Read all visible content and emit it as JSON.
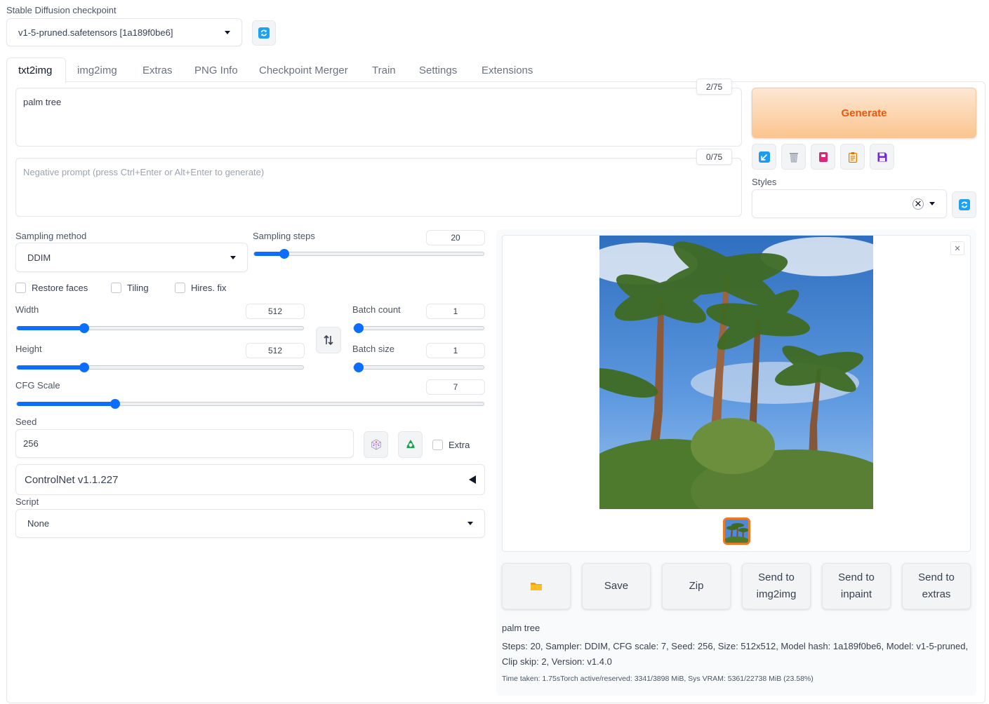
{
  "checkpoint": {
    "label": "Stable Diffusion checkpoint",
    "value": "v1-5-pruned.safetensors [1a189f0be6]"
  },
  "tabs": [
    {
      "label": "txt2img",
      "active": true
    },
    {
      "label": "img2img"
    },
    {
      "label": "Extras"
    },
    {
      "label": "PNG Info"
    },
    {
      "label": "Checkpoint Merger"
    },
    {
      "label": "Train"
    },
    {
      "label": "Settings"
    },
    {
      "label": "Extensions"
    }
  ],
  "prompt": {
    "value": "palm tree",
    "counter": "2/75"
  },
  "negative_prompt": {
    "placeholder": "Negative prompt (press Ctrl+Enter or Alt+Enter to generate)",
    "counter": "0/75"
  },
  "generate_label": "Generate",
  "styles_label": "Styles",
  "sampling": {
    "method_label": "Sampling method",
    "method_value": "DDIM",
    "steps_label": "Sampling steps",
    "steps_value": "20",
    "steps_fraction": 0.13
  },
  "checkboxes": {
    "restore_faces": "Restore faces",
    "tiling": "Tiling",
    "hires_fix": "Hires. fix"
  },
  "width": {
    "label": "Width",
    "value": "512",
    "fraction": 0.235
  },
  "height": {
    "label": "Height",
    "value": "512",
    "fraction": 0.235
  },
  "batch_count": {
    "label": "Batch count",
    "value": "1",
    "fraction": 0.0
  },
  "batch_size": {
    "label": "Batch size",
    "value": "1",
    "fraction": 0.0
  },
  "cfg": {
    "label": "CFG Scale",
    "value": "7",
    "fraction": 0.21
  },
  "seed": {
    "label": "Seed",
    "value": "256",
    "extra_label": "Extra"
  },
  "controlnet": {
    "label": "ControlNet v1.1.227"
  },
  "script": {
    "label": "Script",
    "value": "None"
  },
  "output_buttons": {
    "save": "Save",
    "zip": "Zip",
    "send_img2img": "Send to img2img",
    "send_inpaint": "Send to inpaint",
    "send_extras": "Send to extras"
  },
  "info": {
    "prompt": "palm tree",
    "params": "Steps: 20, Sampler: DDIM, CFG scale: 7, Seed: 256, Size: 512x512, Model hash: 1a189f0be6, Model: v1-5-pruned, Clip skip: 2, Version: v1.4.0",
    "time": "Time taken: 1.75sTorch active/reserved: 3341/3898 MiB, Sys VRAM: 5361/22738 MiB (23.58%)"
  },
  "colors": {
    "accent": "#0d6efd",
    "generate_text": "#ea580c",
    "generate_bg_from": "#fde7d3",
    "generate_bg_to": "#fbc58f",
    "thumbnail_border": "#ea7a24"
  }
}
